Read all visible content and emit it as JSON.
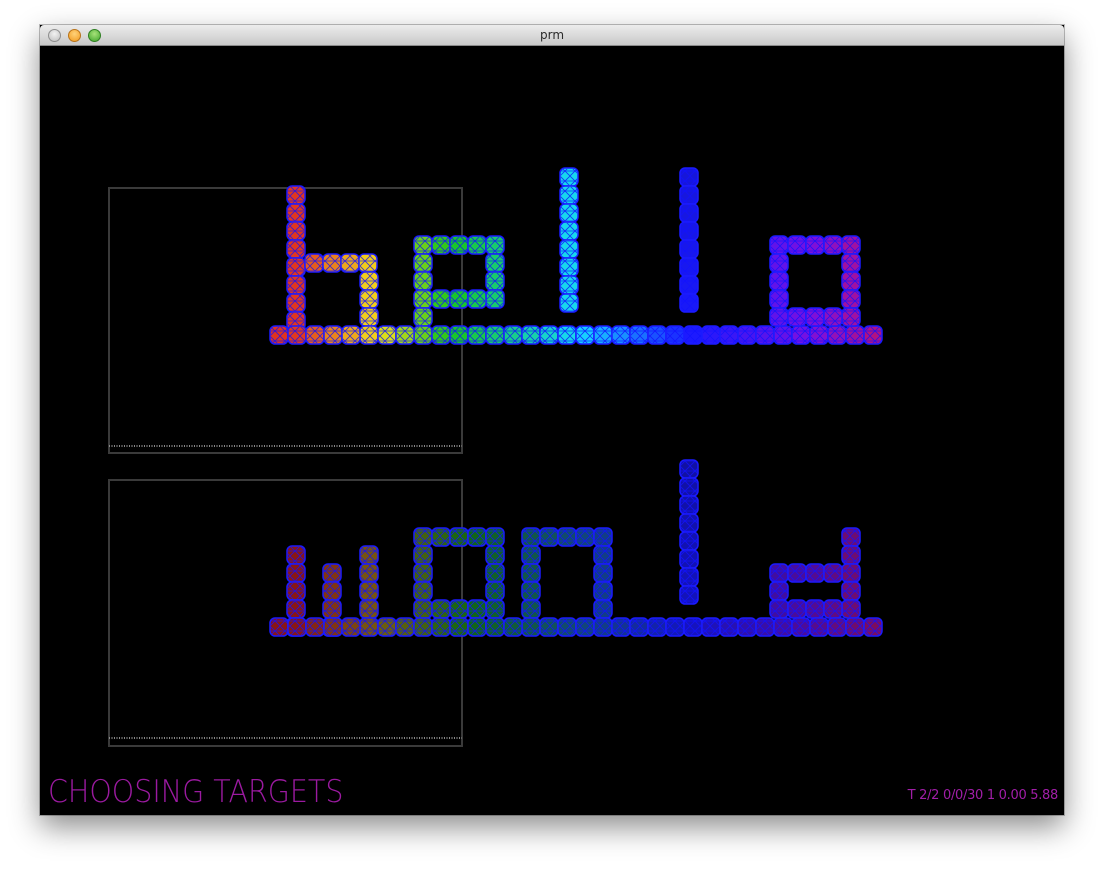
{
  "window": {
    "title": "prm"
  },
  "status": {
    "mode": "CHOOSING  TARGETS",
    "stats": "T  2/2  0/0/30  1  0.00  5.88"
  },
  "colors": {
    "background": "#000000",
    "status_text": "#9b1aa0",
    "panel_border": "#3a3a3a",
    "cell_outline": "#1a1aff"
  },
  "scene": {
    "words": [
      "hello",
      "world"
    ]
  }
}
